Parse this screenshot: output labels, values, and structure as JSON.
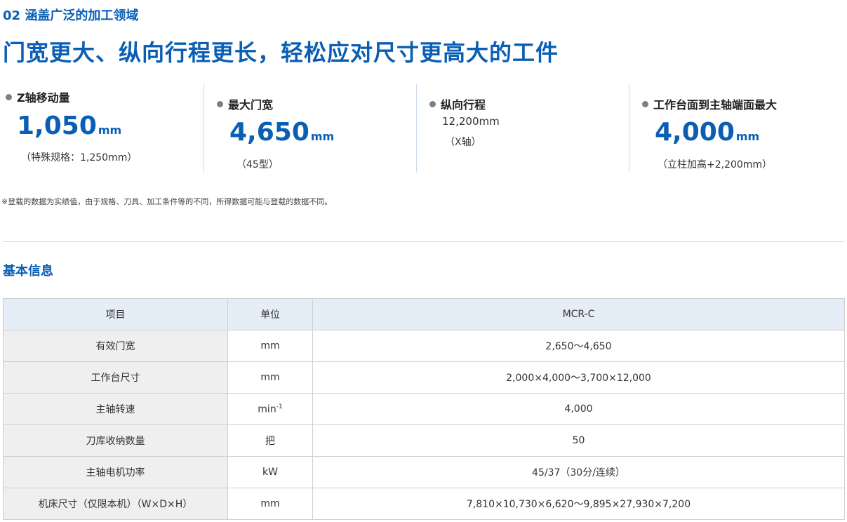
{
  "header": {
    "sub_heading": "02 涵盖广泛的加工领域",
    "main_heading": "门宽更大、纵向行程更长，轻松应对尺寸更高大的工件"
  },
  "specs": [
    {
      "label": "Z轴移动量",
      "value": "1,050",
      "unit": "mm",
      "note": "（特殊规格：1,250mm）"
    },
    {
      "label": "最大门宽",
      "value": "4,650",
      "unit": "mm",
      "note": "（45型）"
    },
    {
      "label": "纵向行程",
      "value": "12,200mm",
      "note": "（X轴）"
    },
    {
      "label": "工作台面到主轴端面最大",
      "value": "4,000",
      "unit": "mm",
      "note": "（立柱加高+2,200mm）"
    }
  ],
  "disclaimer": "※登载的数据为实绩值，由于规格、刀具、加工条件等的不同，所得数据可能与登载的数据不同。",
  "section_title": "基本信息",
  "table": {
    "headers": [
      "项目",
      "单位",
      "MCR-C"
    ],
    "rows": [
      {
        "item": "有效门宽",
        "unit": "mm",
        "value": "2,650～4,650"
      },
      {
        "item": "工作台尺寸",
        "unit": "mm",
        "value": "2,000×4,000～3,700×12,000"
      },
      {
        "item": "主轴转速",
        "unit": "min",
        "unit_sup": "-1",
        "value": "4,000"
      },
      {
        "item": "刀库收纳数量",
        "unit": "把",
        "value": "50"
      },
      {
        "item": "主轴电机功率",
        "unit": "kW",
        "value": "45/37（30分/连续）"
      },
      {
        "item": "机床尺寸（仅限本机）（W×D×H）",
        "unit": "mm",
        "value": "7,810×10,730×6,620～9,895×27,930×7,200"
      }
    ]
  }
}
